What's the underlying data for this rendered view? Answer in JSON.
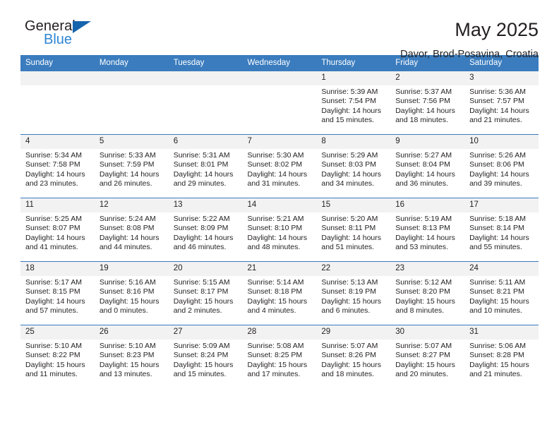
{
  "brand": {
    "name_part1": "General",
    "name_part2": "Blue",
    "flag_icon": "blue-triangle-flag-icon"
  },
  "header": {
    "title": "May 2025",
    "subtitle": "Davor, Brod-Posavina, Croatia"
  },
  "colors": {
    "header_blue": "#3a7cbe",
    "brand_blue": "#2f86d2",
    "flag_blue": "#1463ad",
    "daynum_band": "#f2f2f2",
    "text": "#231f20"
  },
  "labels": {
    "sunrise": "Sunrise:",
    "sunset": "Sunset:",
    "daylight": "Daylight:"
  },
  "weekdays": [
    "Sunday",
    "Monday",
    "Tuesday",
    "Wednesday",
    "Thursday",
    "Friday",
    "Saturday"
  ],
  "weeks": [
    [
      {
        "day": "",
        "empty": true
      },
      {
        "day": "",
        "empty": true
      },
      {
        "day": "",
        "empty": true
      },
      {
        "day": "",
        "empty": true
      },
      {
        "day": "1",
        "sunrise": "Sunrise: 5:39 AM",
        "sunset": "Sunset: 7:54 PM",
        "daylight": "Daylight: 14 hours and 15 minutes."
      },
      {
        "day": "2",
        "sunrise": "Sunrise: 5:37 AM",
        "sunset": "Sunset: 7:56 PM",
        "daylight": "Daylight: 14 hours and 18 minutes."
      },
      {
        "day": "3",
        "sunrise": "Sunrise: 5:36 AM",
        "sunset": "Sunset: 7:57 PM",
        "daylight": "Daylight: 14 hours and 21 minutes."
      }
    ],
    [
      {
        "day": "4",
        "sunrise": "Sunrise: 5:34 AM",
        "sunset": "Sunset: 7:58 PM",
        "daylight": "Daylight: 14 hours and 23 minutes."
      },
      {
        "day": "5",
        "sunrise": "Sunrise: 5:33 AM",
        "sunset": "Sunset: 7:59 PM",
        "daylight": "Daylight: 14 hours and 26 minutes."
      },
      {
        "day": "6",
        "sunrise": "Sunrise: 5:31 AM",
        "sunset": "Sunset: 8:01 PM",
        "daylight": "Daylight: 14 hours and 29 minutes."
      },
      {
        "day": "7",
        "sunrise": "Sunrise: 5:30 AM",
        "sunset": "Sunset: 8:02 PM",
        "daylight": "Daylight: 14 hours and 31 minutes."
      },
      {
        "day": "8",
        "sunrise": "Sunrise: 5:29 AM",
        "sunset": "Sunset: 8:03 PM",
        "daylight": "Daylight: 14 hours and 34 minutes."
      },
      {
        "day": "9",
        "sunrise": "Sunrise: 5:27 AM",
        "sunset": "Sunset: 8:04 PM",
        "daylight": "Daylight: 14 hours and 36 minutes."
      },
      {
        "day": "10",
        "sunrise": "Sunrise: 5:26 AM",
        "sunset": "Sunset: 8:06 PM",
        "daylight": "Daylight: 14 hours and 39 minutes."
      }
    ],
    [
      {
        "day": "11",
        "sunrise": "Sunrise: 5:25 AM",
        "sunset": "Sunset: 8:07 PM",
        "daylight": "Daylight: 14 hours and 41 minutes."
      },
      {
        "day": "12",
        "sunrise": "Sunrise: 5:24 AM",
        "sunset": "Sunset: 8:08 PM",
        "daylight": "Daylight: 14 hours and 44 minutes."
      },
      {
        "day": "13",
        "sunrise": "Sunrise: 5:22 AM",
        "sunset": "Sunset: 8:09 PM",
        "daylight": "Daylight: 14 hours and 46 minutes."
      },
      {
        "day": "14",
        "sunrise": "Sunrise: 5:21 AM",
        "sunset": "Sunset: 8:10 PM",
        "daylight": "Daylight: 14 hours and 48 minutes."
      },
      {
        "day": "15",
        "sunrise": "Sunrise: 5:20 AM",
        "sunset": "Sunset: 8:11 PM",
        "daylight": "Daylight: 14 hours and 51 minutes."
      },
      {
        "day": "16",
        "sunrise": "Sunrise: 5:19 AM",
        "sunset": "Sunset: 8:13 PM",
        "daylight": "Daylight: 14 hours and 53 minutes."
      },
      {
        "day": "17",
        "sunrise": "Sunrise: 5:18 AM",
        "sunset": "Sunset: 8:14 PM",
        "daylight": "Daylight: 14 hours and 55 minutes."
      }
    ],
    [
      {
        "day": "18",
        "sunrise": "Sunrise: 5:17 AM",
        "sunset": "Sunset: 8:15 PM",
        "daylight": "Daylight: 14 hours and 57 minutes."
      },
      {
        "day": "19",
        "sunrise": "Sunrise: 5:16 AM",
        "sunset": "Sunset: 8:16 PM",
        "daylight": "Daylight: 15 hours and 0 minutes."
      },
      {
        "day": "20",
        "sunrise": "Sunrise: 5:15 AM",
        "sunset": "Sunset: 8:17 PM",
        "daylight": "Daylight: 15 hours and 2 minutes."
      },
      {
        "day": "21",
        "sunrise": "Sunrise: 5:14 AM",
        "sunset": "Sunset: 8:18 PM",
        "daylight": "Daylight: 15 hours and 4 minutes."
      },
      {
        "day": "22",
        "sunrise": "Sunrise: 5:13 AM",
        "sunset": "Sunset: 8:19 PM",
        "daylight": "Daylight: 15 hours and 6 minutes."
      },
      {
        "day": "23",
        "sunrise": "Sunrise: 5:12 AM",
        "sunset": "Sunset: 8:20 PM",
        "daylight": "Daylight: 15 hours and 8 minutes."
      },
      {
        "day": "24",
        "sunrise": "Sunrise: 5:11 AM",
        "sunset": "Sunset: 8:21 PM",
        "daylight": "Daylight: 15 hours and 10 minutes."
      }
    ],
    [
      {
        "day": "25",
        "sunrise": "Sunrise: 5:10 AM",
        "sunset": "Sunset: 8:22 PM",
        "daylight": "Daylight: 15 hours and 11 minutes."
      },
      {
        "day": "26",
        "sunrise": "Sunrise: 5:10 AM",
        "sunset": "Sunset: 8:23 PM",
        "daylight": "Daylight: 15 hours and 13 minutes."
      },
      {
        "day": "27",
        "sunrise": "Sunrise: 5:09 AM",
        "sunset": "Sunset: 8:24 PM",
        "daylight": "Daylight: 15 hours and 15 minutes."
      },
      {
        "day": "28",
        "sunrise": "Sunrise: 5:08 AM",
        "sunset": "Sunset: 8:25 PM",
        "daylight": "Daylight: 15 hours and 17 minutes."
      },
      {
        "day": "29",
        "sunrise": "Sunrise: 5:07 AM",
        "sunset": "Sunset: 8:26 PM",
        "daylight": "Daylight: 15 hours and 18 minutes."
      },
      {
        "day": "30",
        "sunrise": "Sunrise: 5:07 AM",
        "sunset": "Sunset: 8:27 PM",
        "daylight": "Daylight: 15 hours and 20 minutes."
      },
      {
        "day": "31",
        "sunrise": "Sunrise: 5:06 AM",
        "sunset": "Sunset: 8:28 PM",
        "daylight": "Daylight: 15 hours and 21 minutes."
      }
    ]
  ]
}
